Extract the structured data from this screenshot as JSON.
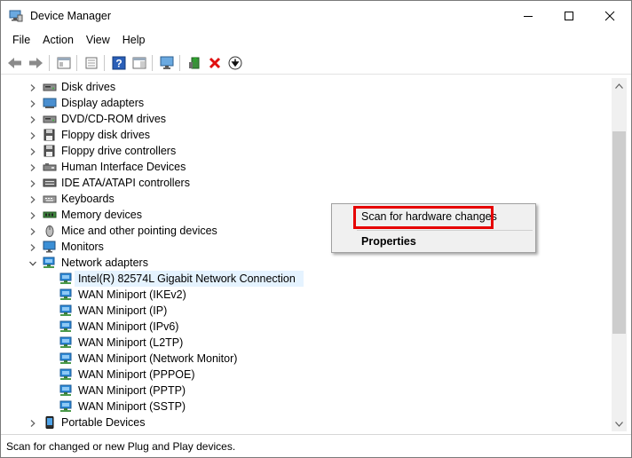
{
  "window": {
    "title": "Device Manager",
    "controls": {
      "minimize": "—",
      "maximize": "☐",
      "close": "✕"
    }
  },
  "menu": [
    "File",
    "Action",
    "View",
    "Help"
  ],
  "toolbar": {
    "buttons": [
      "back-icon",
      "forward-icon",
      "properties-pane-icon",
      "show-hide-console-tree-icon",
      "help-icon",
      "action-pane-icon",
      "monitor-icon",
      "add-driver-icon",
      "uninstall-icon",
      "download-icon"
    ],
    "colors": {
      "uninstall": "#e01010",
      "help": "#2a5fb8"
    }
  },
  "tree": [
    {
      "label": "Disk drives",
      "expanded": false,
      "icon": "disk-drive-icon",
      "level": 0
    },
    {
      "label": "Display adapters",
      "expanded": false,
      "icon": "display-adapter-icon",
      "level": 0
    },
    {
      "label": "DVD/CD-ROM drives",
      "expanded": false,
      "icon": "dvd-drive-icon",
      "level": 0
    },
    {
      "label": "Floppy disk drives",
      "expanded": false,
      "icon": "floppy-disk-icon",
      "level": 0
    },
    {
      "label": "Floppy drive controllers",
      "expanded": false,
      "icon": "floppy-controller-icon",
      "level": 0
    },
    {
      "label": "Human Interface Devices",
      "expanded": false,
      "icon": "hid-icon",
      "level": 0
    },
    {
      "label": "IDE ATA/ATAPI controllers",
      "expanded": false,
      "icon": "ide-controller-icon",
      "level": 0
    },
    {
      "label": "Keyboards",
      "expanded": false,
      "icon": "keyboard-icon",
      "level": 0
    },
    {
      "label": "Memory devices",
      "expanded": false,
      "icon": "memory-icon",
      "level": 0
    },
    {
      "label": "Mice and other pointing devices",
      "expanded": false,
      "icon": "mouse-icon",
      "level": 0
    },
    {
      "label": "Monitors",
      "expanded": false,
      "icon": "monitor-icon",
      "level": 0
    },
    {
      "label": "Network adapters",
      "expanded": true,
      "icon": "network-adapter-icon",
      "level": 0
    },
    {
      "label": "Intel(R) 82574L Gigabit Network Connection",
      "icon": "network-adapter-icon",
      "level": 1,
      "selected": true
    },
    {
      "label": "WAN Miniport (IKEv2)",
      "icon": "network-adapter-icon",
      "level": 1
    },
    {
      "label": "WAN Miniport (IP)",
      "icon": "network-adapter-icon",
      "level": 1
    },
    {
      "label": "WAN Miniport (IPv6)",
      "icon": "network-adapter-icon",
      "level": 1
    },
    {
      "label": "WAN Miniport (L2TP)",
      "icon": "network-adapter-icon",
      "level": 1
    },
    {
      "label": "WAN Miniport (Network Monitor)",
      "icon": "network-adapter-icon",
      "level": 1
    },
    {
      "label": "WAN Miniport (PPPOE)",
      "icon": "network-adapter-icon",
      "level": 1
    },
    {
      "label": "WAN Miniport (PPTP)",
      "icon": "network-adapter-icon",
      "level": 1
    },
    {
      "label": "WAN Miniport (SSTP)",
      "icon": "network-adapter-icon",
      "level": 1
    },
    {
      "label": "Portable Devices",
      "expanded": false,
      "icon": "portable-device-icon",
      "level": 0
    }
  ],
  "context_menu": {
    "items": [
      {
        "label": "Scan for hardware changes",
        "highlighted": true
      },
      {
        "label": "Properties",
        "bold": true
      }
    ],
    "highlight_color": "#e60000"
  },
  "status_bar": {
    "text": "Scan for changed or new Plug and Play devices."
  },
  "colors": {
    "selection": "#e5f3ff",
    "network_icon": "#2e8ad8",
    "scroll_thumb": "#cdcdcd"
  }
}
